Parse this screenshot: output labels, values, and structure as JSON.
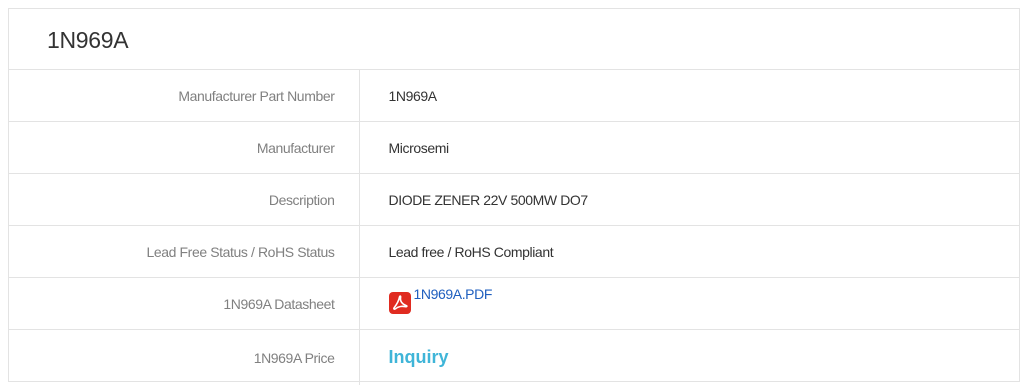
{
  "title": "1N969A",
  "rows": [
    {
      "label": "Manufacturer Part Number",
      "value": "1N969A"
    },
    {
      "label": "Manufacturer",
      "value": "Microsemi"
    },
    {
      "label": "Description",
      "value": "DIODE ZENER 22V 500MW DO7"
    },
    {
      "label": "Lead Free Status / RoHS Status",
      "value": "Lead free / RoHS Compliant"
    },
    {
      "label": "1N969A Datasheet",
      "value": "1N969A.PDF",
      "icon": "pdf-icon"
    },
    {
      "label": "1N969A Price",
      "value": "Inquiry"
    }
  ],
  "colors": {
    "link": "#1f5fbf",
    "inquiry": "#3fb5d8",
    "pdf_icon": "#e02b20",
    "border": "#e3e3e3"
  }
}
